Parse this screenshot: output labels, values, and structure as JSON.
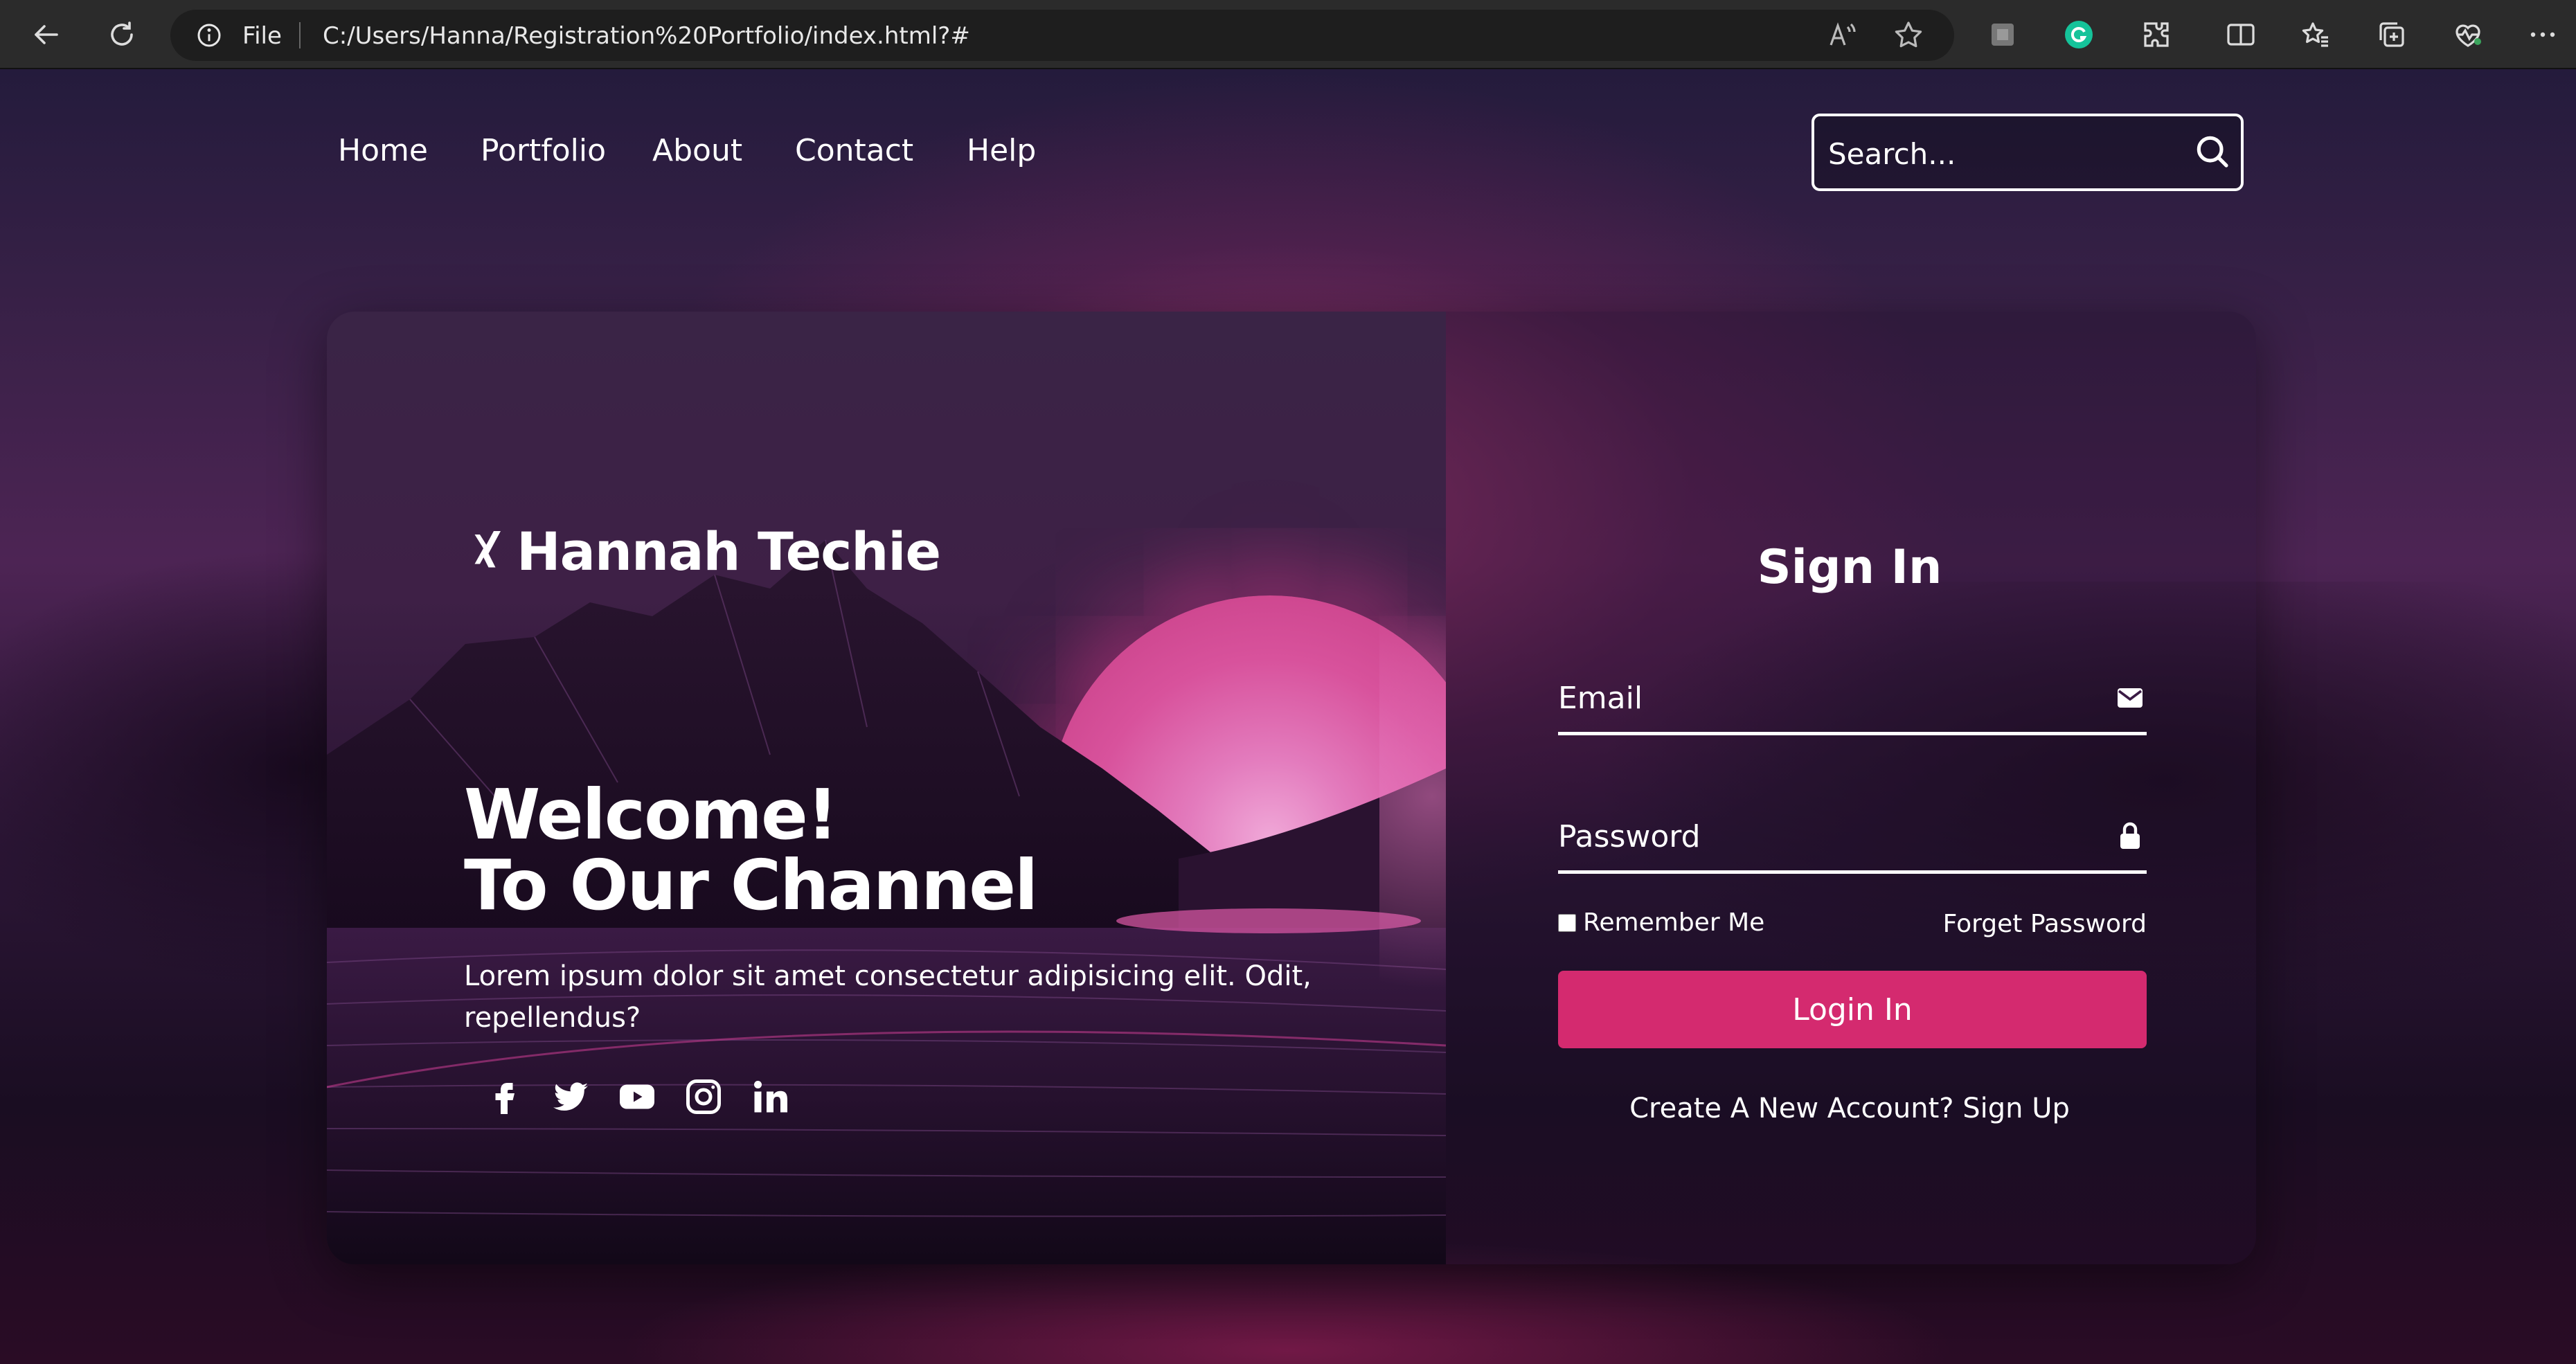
{
  "browser": {
    "address_scheme": "File",
    "url": "C:/Users/Hanna/Registration%20Portfolio/index.html?#"
  },
  "nav": {
    "links": [
      "Home",
      "Portfolio",
      "About",
      "Contact",
      "Help"
    ],
    "search_placeholder": "Search..."
  },
  "hero": {
    "brand": "Hannah Techie",
    "welcome_line1": "Welcome!",
    "welcome_line2": "To Our Channel",
    "description": "Lorem ipsum dolor sit amet consectetur adipisicing elit. Odit, repellendus?",
    "socials": [
      "facebook-icon",
      "twitter-icon",
      "youtube-icon",
      "instagram-icon",
      "linkedin-icon"
    ]
  },
  "signin": {
    "title": "Sign In",
    "email_placeholder": "Email",
    "password_placeholder": "Password",
    "remember_label": "Remember Me",
    "forget_label": "Forget Password",
    "login_label": "Login In",
    "signup_text": "Create A New Account? Sign Up"
  },
  "colors": {
    "accent": "#d42a6f",
    "sun": "#d8529c",
    "background_dark": "#1a0d22"
  }
}
